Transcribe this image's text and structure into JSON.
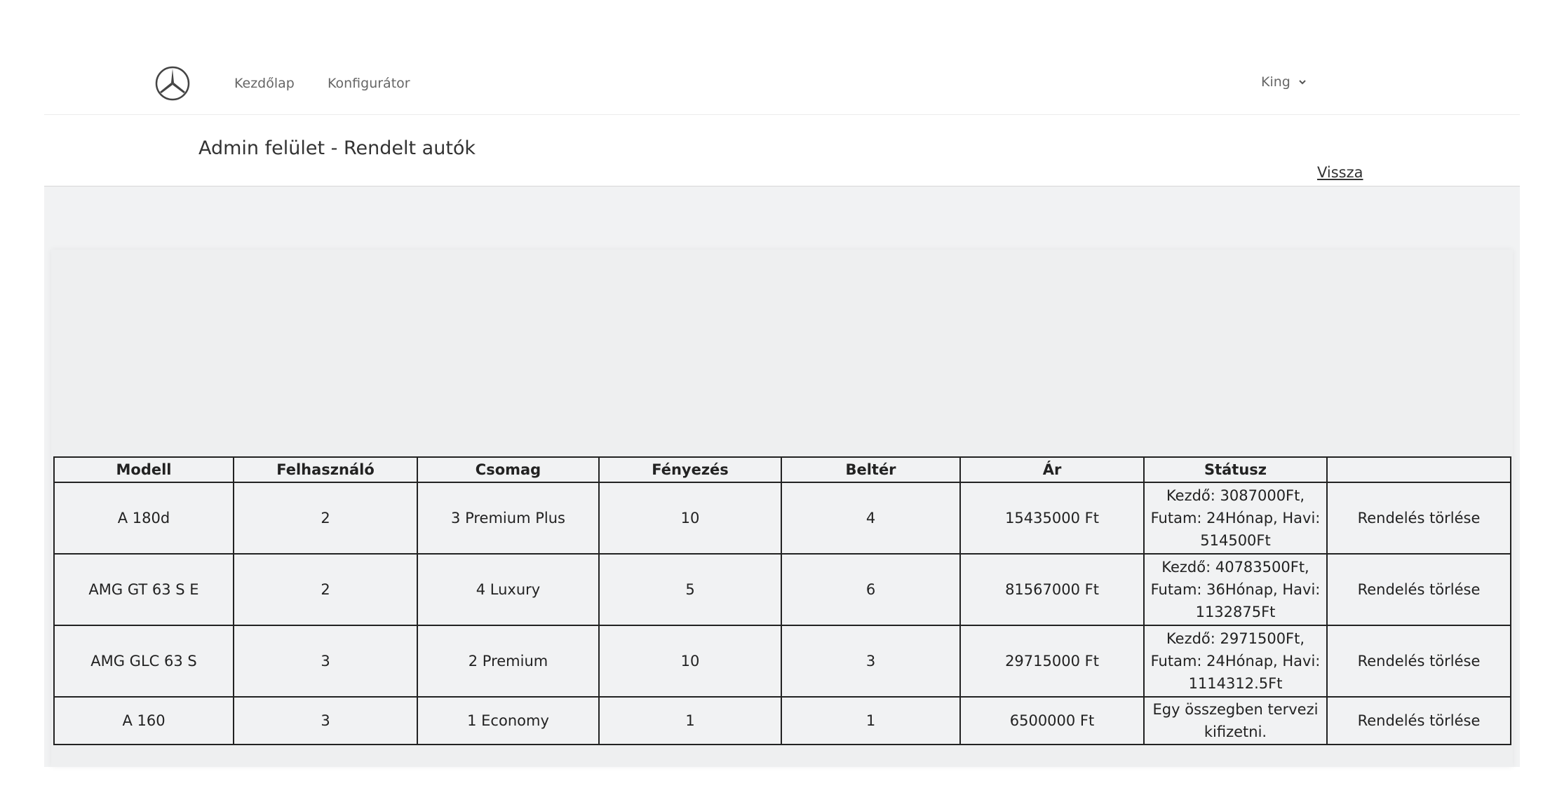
{
  "nav": {
    "home": "Kezdőlap",
    "configurator": "Konfigurátor",
    "user": "King"
  },
  "header": {
    "title": "Admin felület - Rendelt autók",
    "back": "Vissza"
  },
  "table": {
    "columns": [
      "Modell",
      "Felhasználó",
      "Csomag",
      "Fényezés",
      "Beltér",
      "Ár",
      "Státusz",
      ""
    ],
    "rows": [
      {
        "model": "A 180d",
        "user": "2",
        "package": "3 Premium Plus",
        "paint": "10",
        "interior": "4",
        "price": "15435000 Ft",
        "status": "Kezdő: 3087000Ft, Futam: 24Hónap, Havi: 514500Ft",
        "action": "Rendelés törlése"
      },
      {
        "model": "AMG GT 63 S E",
        "user": "2",
        "package": "4 Luxury",
        "paint": "5",
        "interior": "6",
        "price": "81567000 Ft",
        "status": "Kezdő: 40783500Ft, Futam: 36Hónap, Havi: 1132875Ft",
        "action": "Rendelés törlése"
      },
      {
        "model": "AMG GLC 63 S",
        "user": "3",
        "package": "2 Premium",
        "paint": "10",
        "interior": "3",
        "price": "29715000 Ft",
        "status": "Kezdő: 2971500Ft, Futam: 24Hónap, Havi: 1114312.5Ft",
        "action": "Rendelés törlése"
      },
      {
        "model": "A 160",
        "user": "3",
        "package": "1 Economy",
        "paint": "1",
        "interior": "1",
        "price": "6500000 Ft",
        "status": "Egy összegben tervezi kifizetni.",
        "action": "Rendelés törlése"
      }
    ]
  },
  "icons": {
    "logo": "mercedes-star-logo",
    "user_menu": "chevron-down-icon"
  }
}
